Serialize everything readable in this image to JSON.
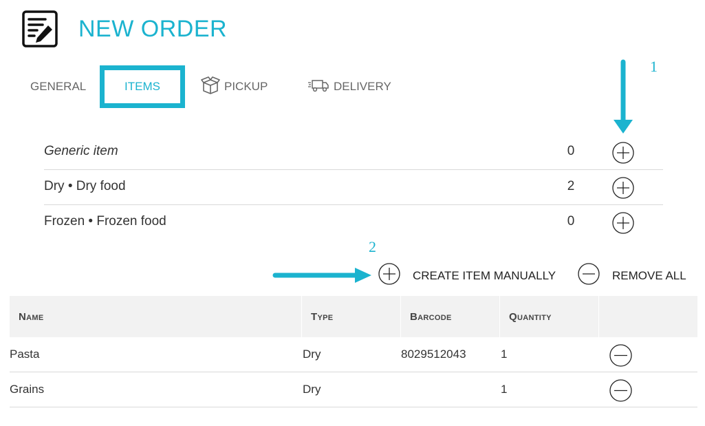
{
  "header": {
    "title": "NEW ORDER",
    "icon": "order-edit-icon"
  },
  "tabs": [
    {
      "label": "GENERAL",
      "active": false
    },
    {
      "label": "ITEMS",
      "active": true
    },
    {
      "label": "PICKUP",
      "icon": "package-box-icon",
      "active": false
    },
    {
      "label": "DELIVERY",
      "icon": "delivery-truck-icon",
      "active": false
    }
  ],
  "items": [
    {
      "name": "Generic item",
      "count": "0"
    },
    {
      "name": "Dry • Dry food",
      "count": "2"
    },
    {
      "name": "Frozen • Frozen food",
      "count": "0"
    }
  ],
  "actions": {
    "create_label": "CREATE ITEM MANUALLY",
    "remove_label": "REMOVE ALL"
  },
  "table": {
    "headers": {
      "name": "Name",
      "type": "Type",
      "barcode": "Barcode",
      "quantity": "Quantity"
    },
    "rows": [
      {
        "name": "Pasta",
        "type": "Dry",
        "barcode": "8029512043",
        "quantity": "1"
      },
      {
        "name": "Grains",
        "type": "Dry",
        "barcode": "",
        "quantity": "1"
      }
    ]
  },
  "annotations": {
    "label_1": "1",
    "label_2": "2"
  },
  "colors": {
    "accent": "#1bb3cf",
    "text": "#333333",
    "header_bg": "#f2f2f2"
  }
}
